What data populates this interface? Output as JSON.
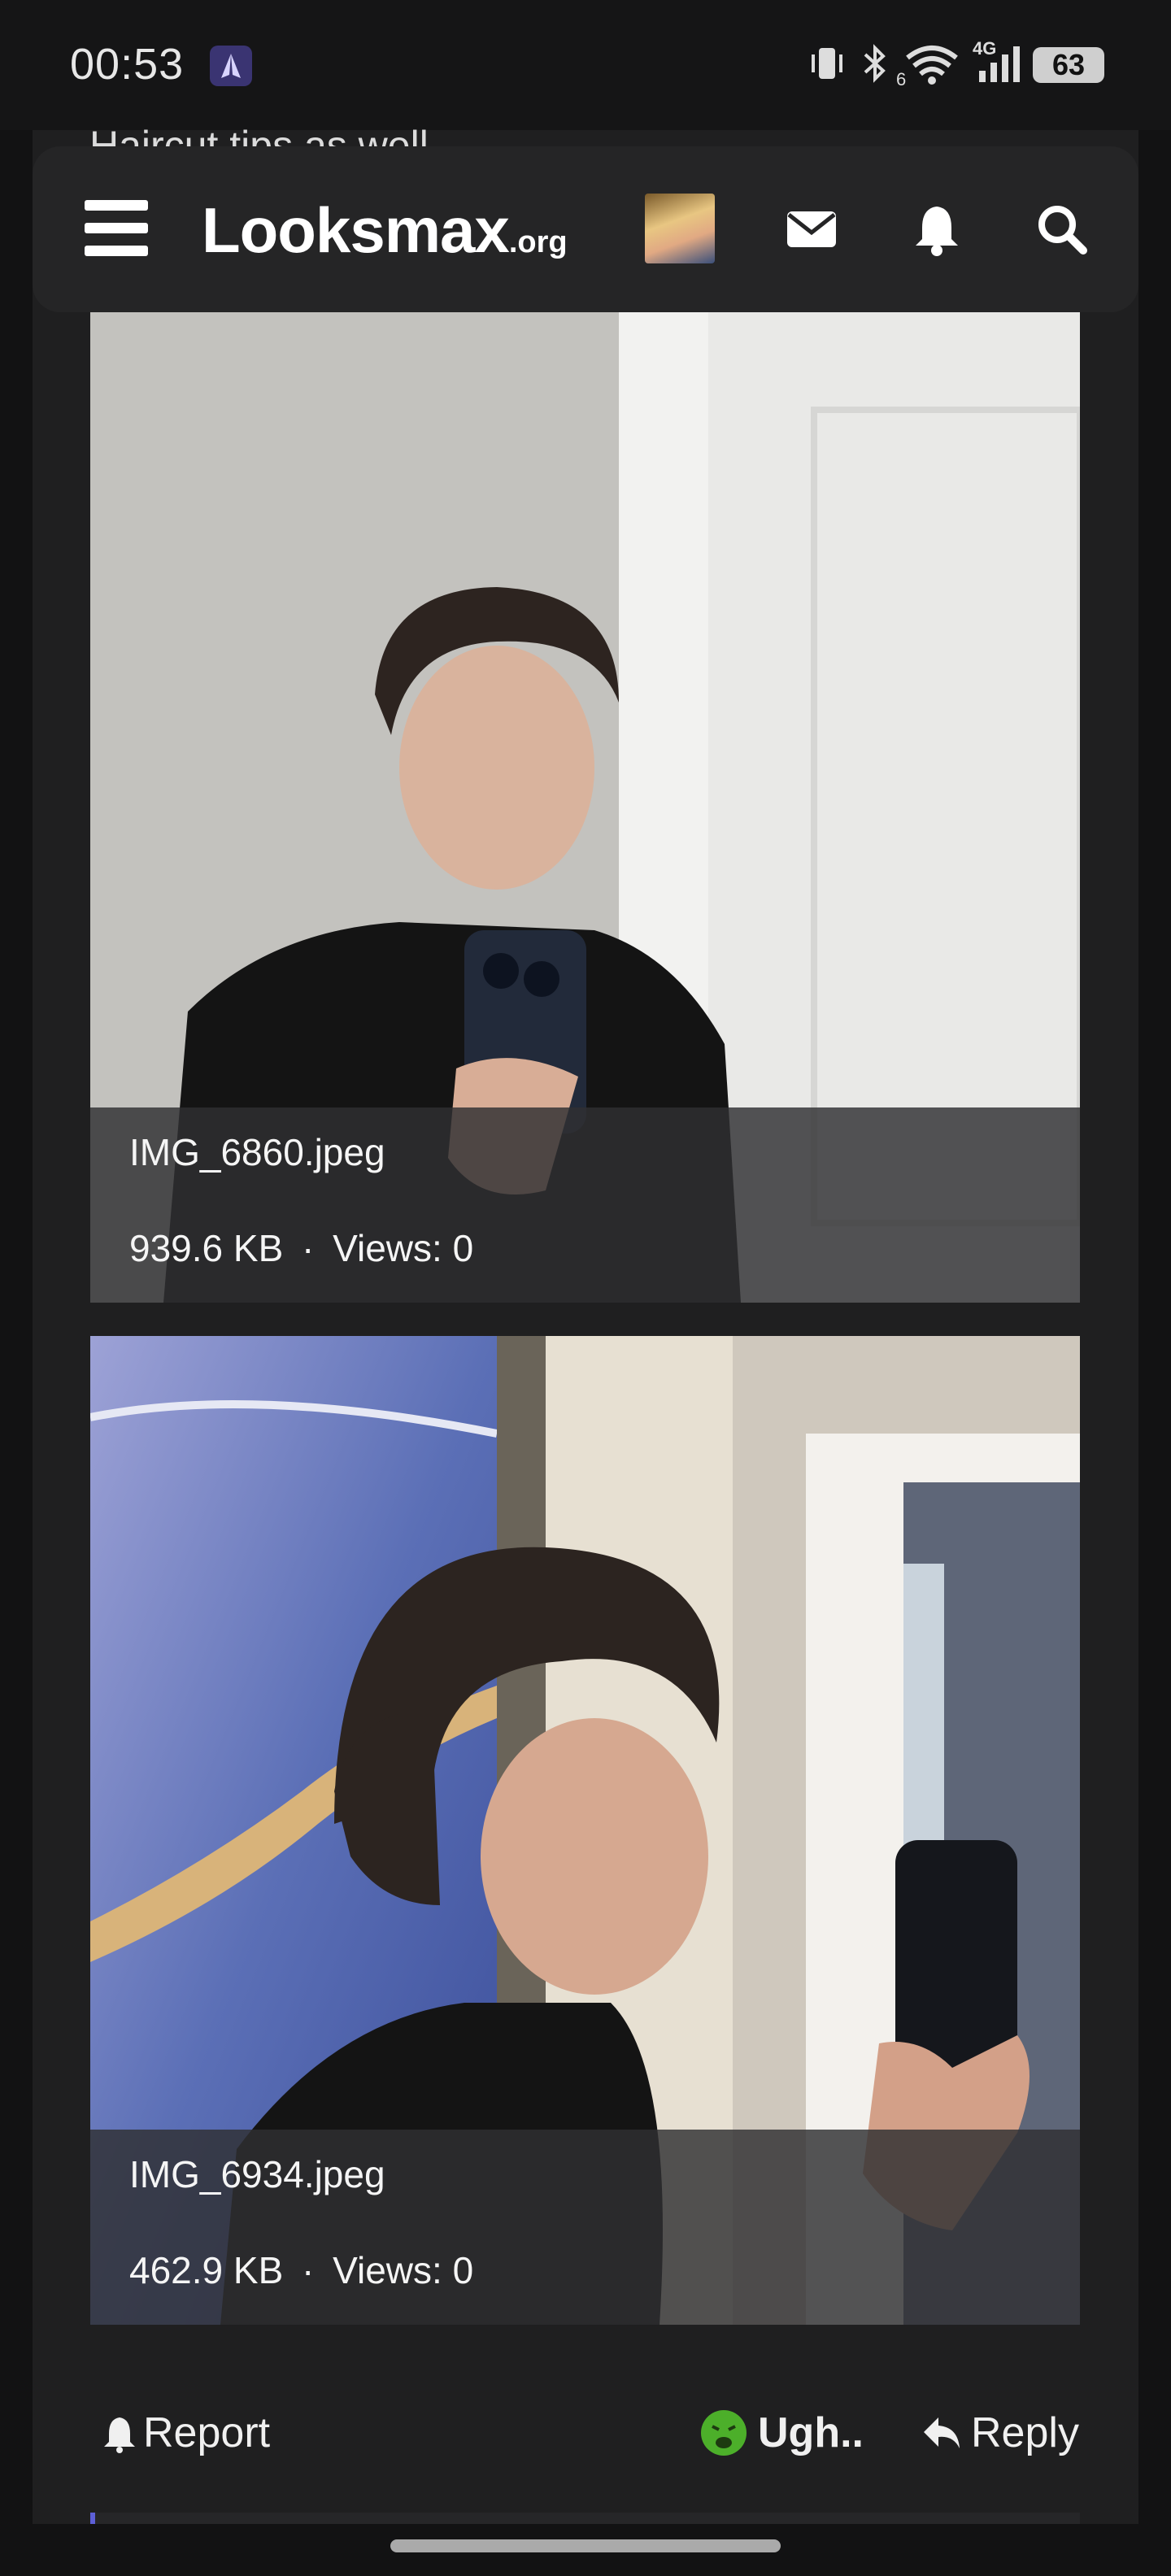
{
  "status_bar": {
    "time": "00:53",
    "network": "4G",
    "wifi_level": "6",
    "battery": "63",
    "icons": [
      "app-notification-icon",
      "vibrate-icon",
      "bluetooth-icon",
      "wifi-icon",
      "signal-icon",
      "battery-icon"
    ]
  },
  "page": {
    "partial_text_above": "Haircut tips as well"
  },
  "header": {
    "logo_main": "Looksmax",
    "logo_tld": ".org",
    "icons": [
      "menu-icon",
      "avatar",
      "mail-icon",
      "bell-icon",
      "search-icon"
    ]
  },
  "attachments": [
    {
      "filename": "IMG_6860.jpeg",
      "size": "939.6 KB",
      "views": "Views: 0"
    },
    {
      "filename": "IMG_6934.jpeg",
      "size": "462.9 KB",
      "views": "Views: 0"
    }
  ],
  "meta_separator": "·",
  "actions": {
    "report_label": "Report",
    "reaction_label": "Ugh..",
    "reply_label": "Reply"
  },
  "colors": {
    "background": "#121213",
    "card": "#1f1f20",
    "header": "#252526",
    "accent": "#5d5fd6",
    "reaction_green": "#4caf2a"
  }
}
